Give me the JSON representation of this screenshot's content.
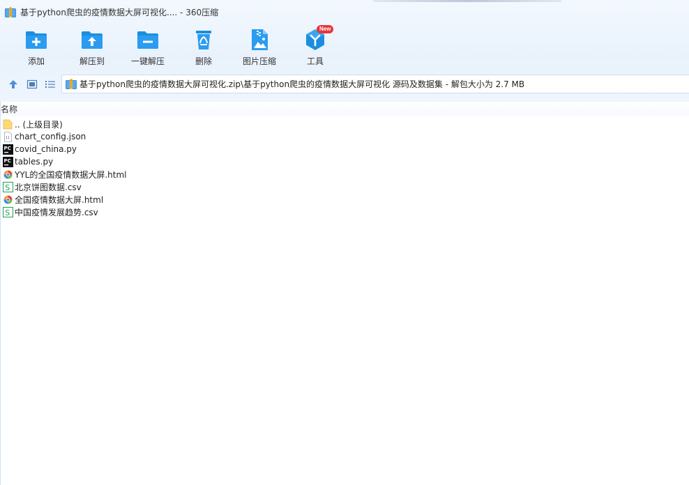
{
  "window": {
    "title": "基于python爬虫的疫情数据大屏可视化.... - 360压缩"
  },
  "toolbar": {
    "items": [
      {
        "label": "添加",
        "icon": "add-folder-icon"
      },
      {
        "label": "解压到",
        "icon": "extract-to-folder-icon"
      },
      {
        "label": "一键解压",
        "icon": "one-click-extract-icon"
      },
      {
        "label": "删除",
        "icon": "recycle-bin-icon"
      },
      {
        "label": "图片压缩",
        "icon": "image-compress-icon"
      },
      {
        "label": "工具",
        "icon": "tools-cube-icon",
        "badge": "New"
      }
    ]
  },
  "address": {
    "path": "基于python爬虫的疫情数据大屏可视化.zip\\基于python爬虫的疫情数据大屏可视化 源码及数据集 - 解包大小为 2.7 MB"
  },
  "list": {
    "header": "名称",
    "files": [
      {
        "name": ".. (上级目录)",
        "type": "folder"
      },
      {
        "name": "chart_config.json",
        "type": "json"
      },
      {
        "name": "covid_china.py",
        "type": "pycharm"
      },
      {
        "name": "tables.py",
        "type": "pycharm"
      },
      {
        "name": "YYL的全国疫情数据大屏.html",
        "type": "html"
      },
      {
        "name": "北京饼图数据.csv",
        "type": "csv"
      },
      {
        "name": "全国疫情数据大屏.html",
        "type": "html"
      },
      {
        "name": "中国疫情发展趋势.csv",
        "type": "csv"
      }
    ]
  },
  "colors": {
    "toolbar_icon": "#1a8fe0",
    "badge": "#e8353a",
    "csv_green": "#1f9d55"
  }
}
